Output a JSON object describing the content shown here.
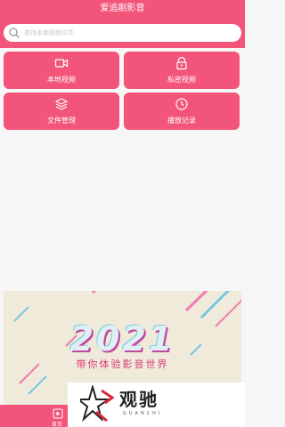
{
  "app": {
    "title": "爱追剧影音"
  },
  "search": {
    "placeholder": "查找本地视频文件",
    "icon": "search-icon"
  },
  "tiles": [
    {
      "label": "本地视频",
      "icon": "video-camera-icon"
    },
    {
      "label": "私密视频",
      "icon": "lock-icon"
    },
    {
      "label": "文件管理",
      "icon": "layers-icon"
    },
    {
      "label": "播放记录",
      "icon": "clock-icon"
    }
  ],
  "banner": {
    "year": "2021",
    "slogan": "带你体验影音世界"
  },
  "tabbar": {
    "label": "首页",
    "icon": "play-tab-icon"
  },
  "watermark": {
    "text": "观驰",
    "subtext": "GUANCHI"
  },
  "colors": {
    "primary": "#f2547a",
    "background": "#f6f6f6"
  }
}
